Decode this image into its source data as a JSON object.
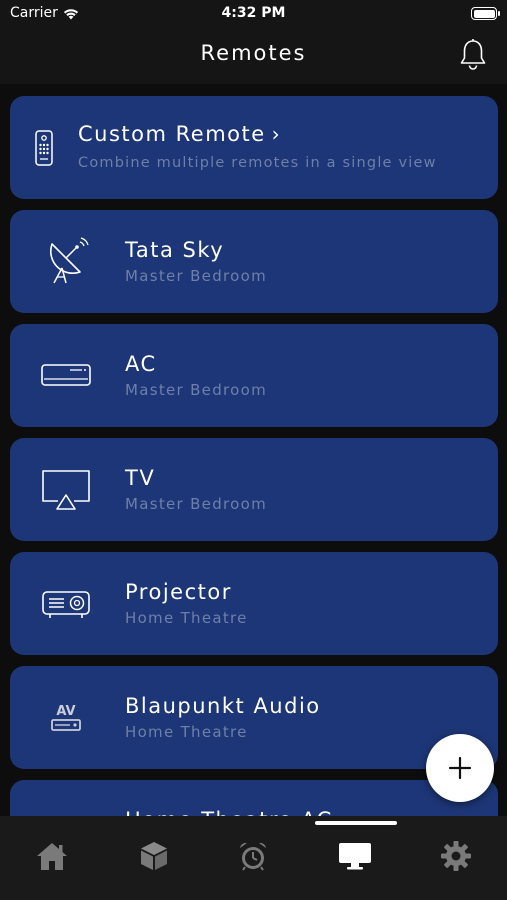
{
  "status": {
    "carrier": "Carrier",
    "time": "4:32 PM"
  },
  "nav": {
    "title": "Remotes",
    "icon": "bell-icon"
  },
  "custom_remote": {
    "title": "Custom Remote",
    "subtitle": "Combine multiple remotes in a single view",
    "icon": "remote-control-icon"
  },
  "remotes": [
    {
      "title": "Tata Sky",
      "subtitle": "Master Bedroom",
      "icon": "satellite-dish-icon"
    },
    {
      "title": "AC",
      "subtitle": "Master Bedroom",
      "icon": "air-conditioner-icon"
    },
    {
      "title": "TV",
      "subtitle": "Master Bedroom",
      "icon": "tv-airplay-icon"
    },
    {
      "title": "Projector",
      "subtitle": "Home Theatre",
      "icon": "projector-icon"
    },
    {
      "title": "Blaupunkt Audio",
      "subtitle": "Home Theatre",
      "icon": "av-receiver-icon",
      "icon_text": "AV"
    },
    {
      "title": "Home Theatre AC",
      "subtitle": "",
      "icon": "air-conditioner-icon"
    }
  ],
  "fab": {
    "icon": "plus-icon"
  },
  "tabs": [
    {
      "name": "home",
      "icon": "home-icon",
      "active": false
    },
    {
      "name": "devices",
      "icon": "cube-icon",
      "active": false
    },
    {
      "name": "alarms",
      "icon": "alarm-clock-icon",
      "active": false
    },
    {
      "name": "remotes",
      "icon": "monitor-icon",
      "active": true
    },
    {
      "name": "settings",
      "icon": "gear-icon",
      "active": false
    }
  ],
  "colors": {
    "card": "#1d3677",
    "subtitle": "#6e7fa8",
    "tab_inactive": "#7a7a7a",
    "tab_active": "#ffffff"
  }
}
